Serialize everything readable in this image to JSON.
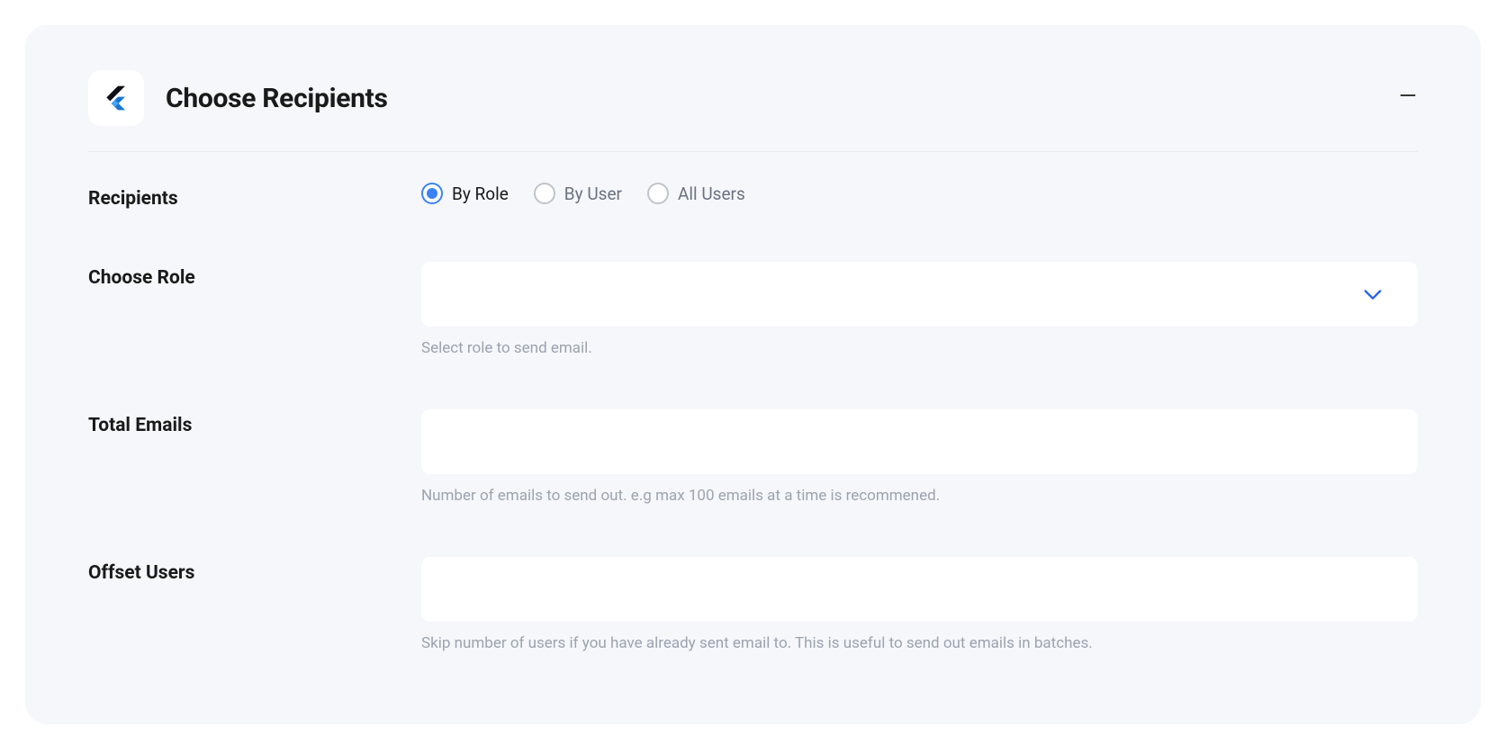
{
  "panel": {
    "title": "Choose Recipients"
  },
  "fields": {
    "recipients": {
      "label": "Recipients",
      "options": {
        "byRole": "By Role",
        "byUser": "By User",
        "allUsers": "All Users"
      }
    },
    "chooseRole": {
      "label": "Choose Role",
      "helper": "Select role to send email."
    },
    "totalEmails": {
      "label": "Total Emails",
      "helper": "Number of emails to send out. e.g max 100 emails at a time is recommened."
    },
    "offsetUsers": {
      "label": "Offset Users",
      "helper": "Skip number of users if you have already sent email to. This is useful to send out emails in batches."
    }
  }
}
